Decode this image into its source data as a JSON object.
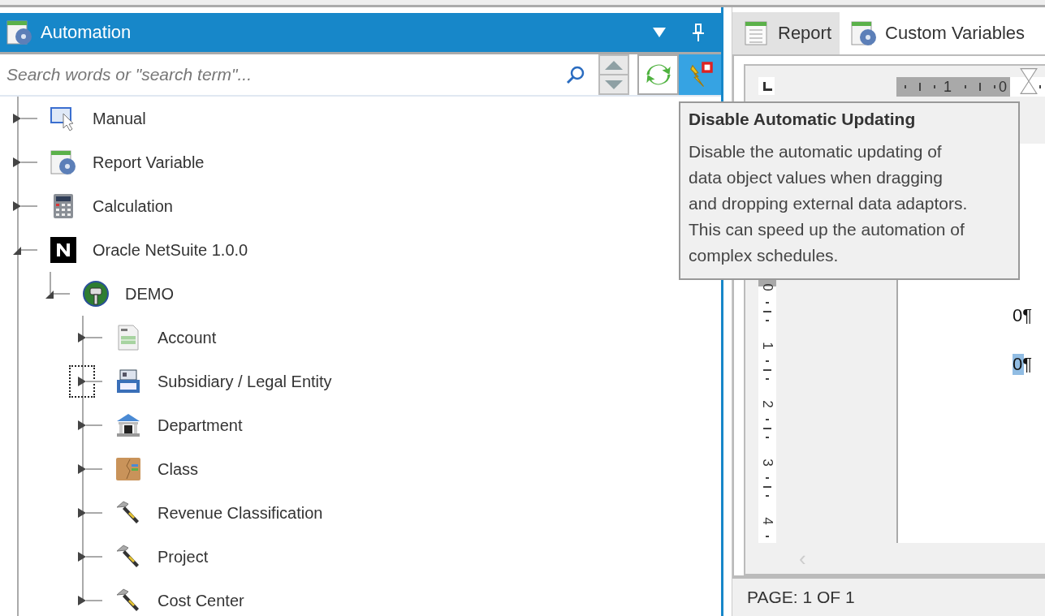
{
  "left_panel": {
    "title": "Automation",
    "search": {
      "placeholder": "Search words or \"search term\"..."
    },
    "tree": [
      {
        "label": "Manual",
        "kind": "manual",
        "expanded": false,
        "focused": false
      },
      {
        "label": "Report Variable",
        "kind": "variable",
        "expanded": false,
        "focused": false
      },
      {
        "label": "Calculation",
        "kind": "calculator",
        "expanded": false,
        "focused": false
      },
      {
        "label": "Oracle NetSuite 1.0.0",
        "kind": "netsuite",
        "expanded": true,
        "focused": false,
        "children": [
          {
            "label": "DEMO",
            "kind": "database",
            "expanded": true,
            "focused": false,
            "children": [
              {
                "label": "Account",
                "kind": "form",
                "expanded": false,
                "focused": false
              },
              {
                "label": "Subsidiary / Legal Entity",
                "kind": "register",
                "expanded": false,
                "focused": true
              },
              {
                "label": "Department",
                "kind": "building",
                "expanded": false,
                "focused": false
              },
              {
                "label": "Class",
                "kind": "folder",
                "expanded": false,
                "focused": false
              },
              {
                "label": "Revenue Classification",
                "kind": "hammer",
                "expanded": false,
                "focused": false
              },
              {
                "label": "Project",
                "kind": "hammer",
                "expanded": false,
                "focused": false
              },
              {
                "label": "Cost Center",
                "kind": "hammer",
                "expanded": false,
                "focused": false
              }
            ]
          }
        ]
      }
    ]
  },
  "right_panel": {
    "tabs": [
      {
        "label": "Report",
        "kind": "report",
        "selected": true
      },
      {
        "label": "Custom Variables",
        "kind": "variable",
        "selected": false
      }
    ],
    "ruler": {
      "h_labels": [
        "1",
        "0"
      ],
      "v_labels": [
        "0",
        "1",
        "2",
        "3",
        "4"
      ]
    },
    "paragraphs": [
      {
        "text": "0¶",
        "selected": false
      },
      {
        "text": "0¶",
        "selected": true
      }
    ],
    "scroll_left": "‹",
    "status": "PAGE: 1 OF 1"
  },
  "tooltip": {
    "title": "Disable Automatic Updating",
    "body": "Disable the automatic updating of data object values when dragging and dropping external data adaptors. This can speed up the automation of complex schedules."
  }
}
